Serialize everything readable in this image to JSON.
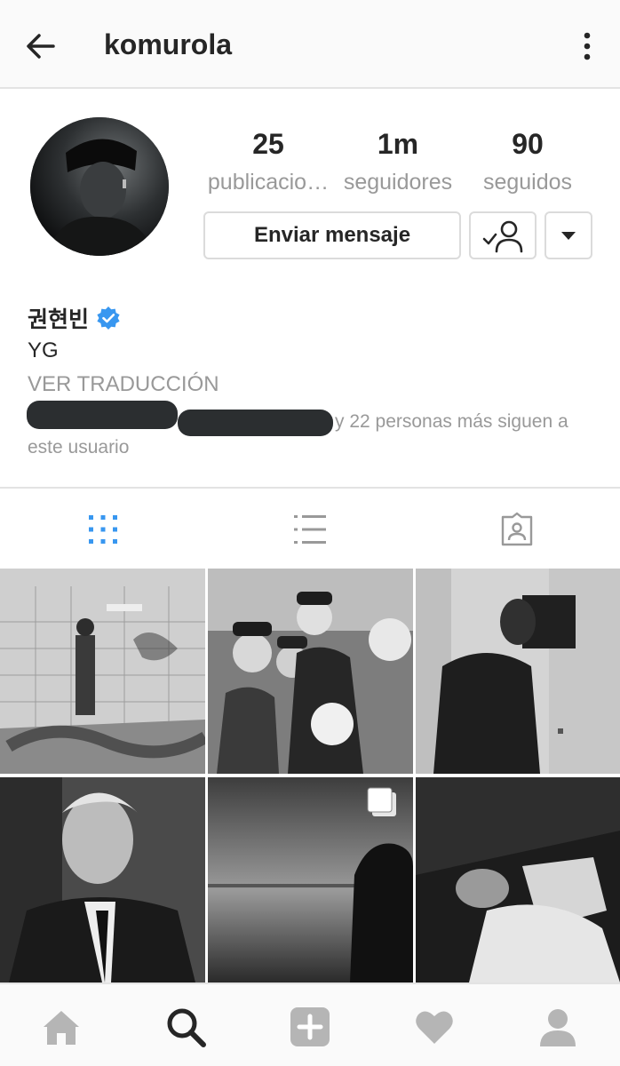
{
  "header": {
    "username": "komurola",
    "back_icon": "arrow-left-icon",
    "more_icon": "more-vertical-icon"
  },
  "profile": {
    "stats": [
      {
        "value": "25",
        "label": "publicacio…"
      },
      {
        "value": "1m",
        "label": "seguidores"
      },
      {
        "value": "90",
        "label": "seguidos"
      }
    ],
    "message_button": "Enviar mensaje",
    "follow_icon": "following-check-user-icon",
    "dropdown_icon": "caret-down-icon"
  },
  "bio": {
    "name": "권현빈",
    "text": "YG",
    "translate": "VER TRADUCCIÓN",
    "followed_by_suffix": "y 22 personas más siguen a",
    "followed_by_line2": "este usuario"
  },
  "tabs": [
    {
      "icon": "grid-view-icon",
      "active": true
    },
    {
      "icon": "list-view-icon",
      "active": false
    },
    {
      "icon": "tagged-photos-icon",
      "active": false
    }
  ],
  "nav": [
    {
      "icon": "home-icon",
      "active": false
    },
    {
      "icon": "search-icon",
      "active": true
    },
    {
      "icon": "add-post-icon",
      "active": false
    },
    {
      "icon": "heart-icon",
      "active": false
    },
    {
      "icon": "profile-icon",
      "active": false
    }
  ],
  "colors": {
    "accent_blue": "#3897f0",
    "muted_gray": "#999999",
    "text_dark": "#262626",
    "border": "#dbdbdb"
  }
}
